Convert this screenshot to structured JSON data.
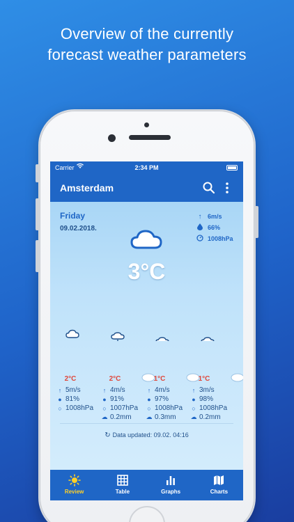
{
  "headline": {
    "line1": "Overview of the currently",
    "line2": "forecast weather parameters"
  },
  "status_bar": {
    "carrier": "Carrier",
    "time": "2:34 PM"
  },
  "app_bar": {
    "city": "Amsterdam"
  },
  "current": {
    "day": "Friday",
    "date": "09.02.2018.",
    "wind": "6m/s",
    "humidity": "66%",
    "pressure": "1008hPa",
    "temperature": "3°C"
  },
  "forecast": [
    {
      "temp": "2°C",
      "wind": "5m/s",
      "humidity": "81%",
      "pressure": "1008hPa",
      "precip": ""
    },
    {
      "temp": "2°C",
      "wind": "4m/s",
      "humidity": "91%",
      "pressure": "1007hPa",
      "precip": "0.2mm"
    },
    {
      "temp": "1°C",
      "wind": "4m/s",
      "humidity": "97%",
      "pressure": "1008hPa",
      "precip": "0.3mm"
    },
    {
      "temp": "1°C",
      "wind": "3m/s",
      "humidity": "98%",
      "pressure": "1008hPa",
      "precip": "0.2mm"
    }
  ],
  "updated": "Data updated: 09.02. 04:16",
  "tabs": {
    "review": "Review",
    "table": "Table",
    "graphs": "Graphs",
    "charts": "Charts"
  },
  "colors": {
    "primary": "#1f66c6",
    "accent_active": "#ffd027",
    "temp_red": "#e0473a"
  }
}
